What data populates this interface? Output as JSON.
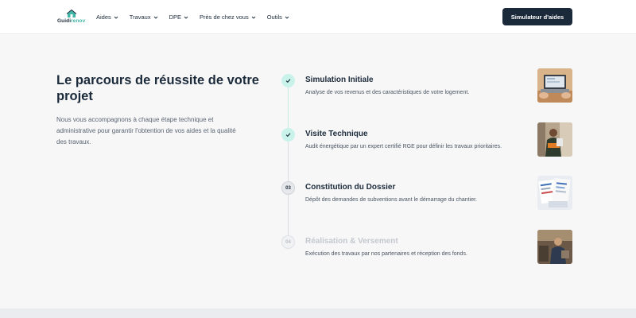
{
  "header": {
    "logo": {
      "part1": "Guidi",
      "part2": "renov"
    },
    "nav": [
      {
        "label": "Aides"
      },
      {
        "label": "Travaux"
      },
      {
        "label": "DPE"
      },
      {
        "label": "Près de chez vous"
      },
      {
        "label": "Outils"
      }
    ],
    "cta_label": "Simulateur d'aides"
  },
  "main": {
    "title": "Le parcours de réussite de votre projet",
    "description": "Nous vous accompagnons à chaque étape technique et administrative pour garantir l'obtention de vos aides et la qualité des travaux.",
    "steps": [
      {
        "badge": "",
        "status": "done",
        "title": "Simulation Initiale",
        "description": "Analyse de vos revenus et des caractéristiques de votre logement.",
        "image": "laptop-photo"
      },
      {
        "badge": "",
        "status": "done",
        "title": "Visite Technique",
        "description": "Audit énergétique par un expert certifié RGE pour définir les travaux prioritaires.",
        "image": "technician-photo"
      },
      {
        "badge": "03",
        "status": "current",
        "title": "Constitution du Dossier",
        "description": "Dépôt des demandes de subventions avant le démarrage du chantier.",
        "image": "documents-photo"
      },
      {
        "badge": "04",
        "status": "future",
        "title": "Réalisation & Versement",
        "description": "Exécution des travaux par nos partenaires et réception des fonds.",
        "image": "worker-photo"
      }
    ]
  },
  "colors": {
    "primary": "#1b2a3a",
    "accent": "#3fb6a6",
    "done_badge": "#c9f3ea"
  }
}
